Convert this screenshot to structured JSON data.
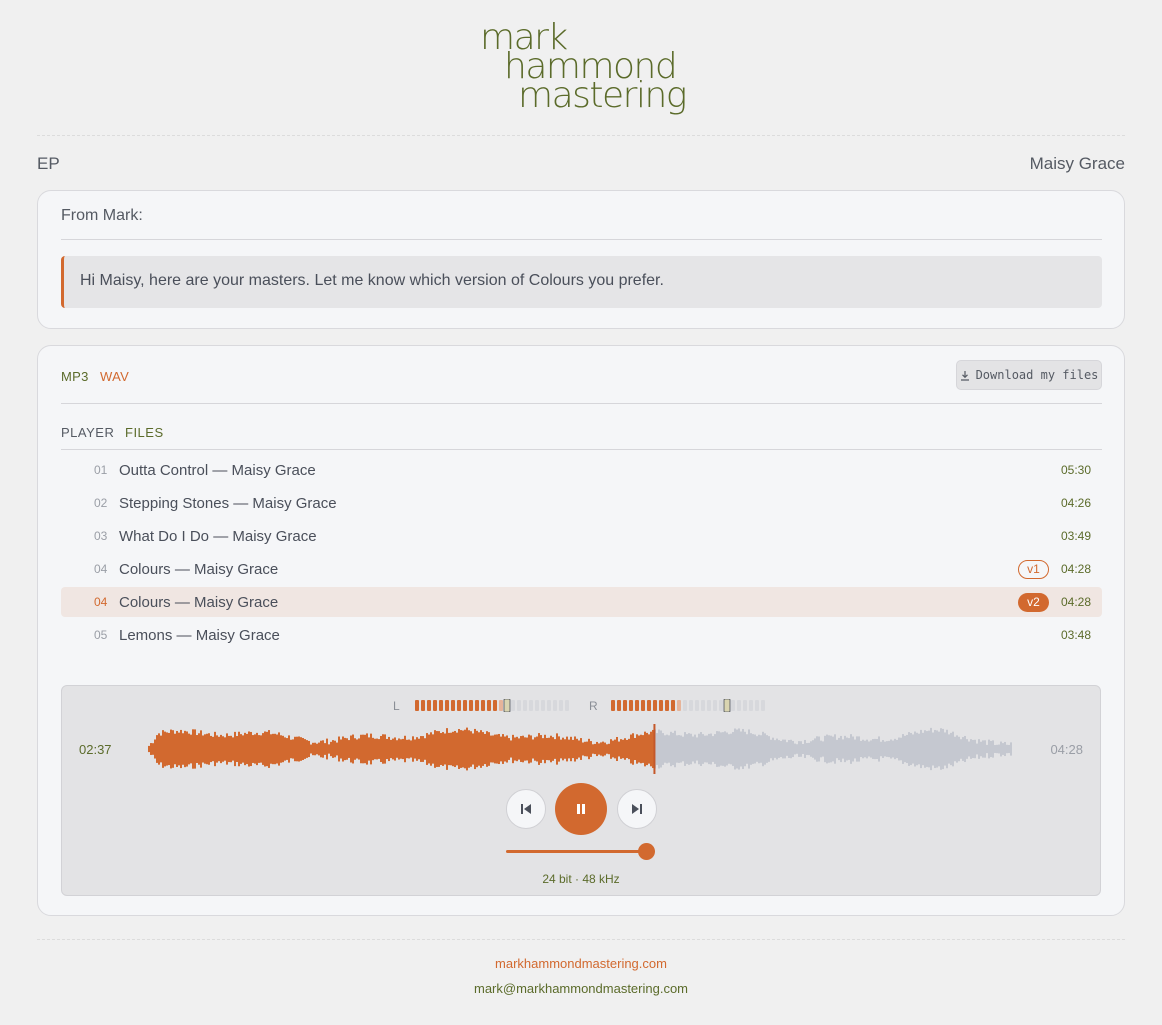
{
  "brand": {
    "logo_lines": [
      "mark",
      "hammond",
      "mastering"
    ],
    "accent": "#d2692f",
    "olive": "#5b6b2a"
  },
  "header": {
    "release_type": "EP",
    "artist": "Maisy Grace"
  },
  "message": {
    "label": "From Mark:",
    "body": "Hi Maisy, here are your masters. Let me know which version of Colours you prefer."
  },
  "formats": {
    "mp3": "MP3",
    "wav": "WAV",
    "download_label": "Download my files",
    "download_icon": "download-icon"
  },
  "tabs": {
    "player": "PLAYER",
    "files": "FILES"
  },
  "tracks": [
    {
      "num": "01",
      "title": "Outta Control — Maisy Grace",
      "duration": "05:30",
      "badge": ""
    },
    {
      "num": "02",
      "title": "Stepping Stones — Maisy Grace",
      "duration": "04:26",
      "badge": ""
    },
    {
      "num": "03",
      "title": "What Do I Do — Maisy Grace",
      "duration": "03:49",
      "badge": ""
    },
    {
      "num": "04",
      "title": "Colours — Maisy Grace",
      "duration": "04:28",
      "badge": "v1"
    },
    {
      "num": "04",
      "title": "Colours — Maisy Grace",
      "duration": "04:28",
      "badge": "v2"
    },
    {
      "num": "05",
      "title": "Lemons — Maisy Grace",
      "duration": "03:48",
      "badge": ""
    }
  ],
  "active_track_index": 4,
  "player": {
    "current_time": "02:37",
    "total_time": "04:28",
    "progress": 0.585,
    "meter_left_label": "L",
    "meter_right_label": "R",
    "meter_left_level": 0.55,
    "meter_right_level": 0.41,
    "meter_left_peak": 0.58,
    "meter_right_peak": 0.72,
    "volume": 1.0,
    "quality": "24 bit · 48 kHz",
    "prev_icon": "skip-previous-icon",
    "play_icon": "pause-icon",
    "next_icon": "skip-next-icon"
  },
  "footer": {
    "site": "markhammondmastering.com",
    "email": "mark@markhammondmastering.com"
  }
}
